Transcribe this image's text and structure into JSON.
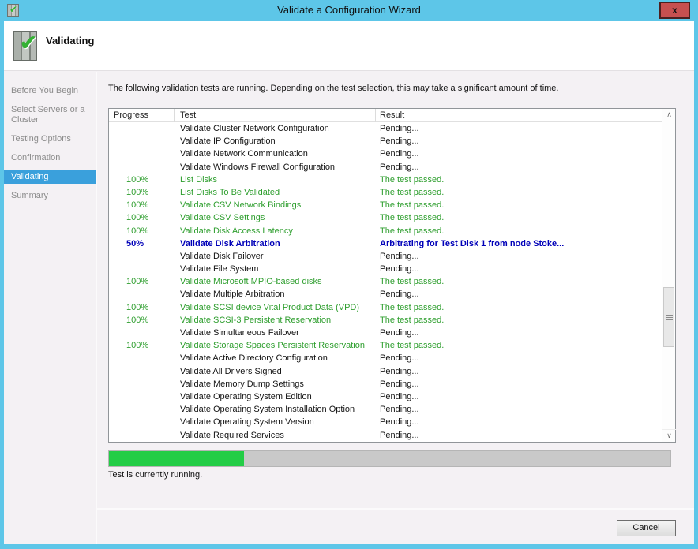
{
  "window": {
    "title": "Validate a Configuration Wizard",
    "close_label": "x"
  },
  "header": {
    "title": "Validating"
  },
  "icons": {
    "check": "✔",
    "scroll_up": "∧",
    "scroll_down": "∨"
  },
  "sidebar": {
    "items": [
      {
        "id": "before-you-begin",
        "label": "Before You Begin",
        "active": false
      },
      {
        "id": "select-servers-or-a-cluster",
        "label": "Select Servers or a Cluster",
        "active": false
      },
      {
        "id": "testing-options",
        "label": "Testing Options",
        "active": false
      },
      {
        "id": "confirmation",
        "label": "Confirmation",
        "active": false
      },
      {
        "id": "validating",
        "label": "Validating",
        "active": true
      },
      {
        "id": "summary",
        "label": "Summary",
        "active": false
      }
    ]
  },
  "main": {
    "instruction": "The following validation tests are running. Depending on the test selection, this may take a significant amount of time.",
    "table": {
      "columns": {
        "progress": "Progress",
        "test": "Test",
        "result": "Result"
      },
      "rows": [
        {
          "progress": "",
          "test": "Validate Cluster Network Configuration",
          "result": "Pending...",
          "status": "pending"
        },
        {
          "progress": "",
          "test": "Validate IP Configuration",
          "result": "Pending...",
          "status": "pending"
        },
        {
          "progress": "",
          "test": "Validate Network Communication",
          "result": "Pending...",
          "status": "pending"
        },
        {
          "progress": "",
          "test": "Validate Windows Firewall Configuration",
          "result": "Pending...",
          "status": "pending"
        },
        {
          "progress": "100%",
          "test": "List Disks",
          "result": "The test passed.",
          "status": "passed"
        },
        {
          "progress": "100%",
          "test": "List Disks To Be Validated",
          "result": "The test passed.",
          "status": "passed"
        },
        {
          "progress": "100%",
          "test": "Validate CSV Network Bindings",
          "result": "The test passed.",
          "status": "passed"
        },
        {
          "progress": "100%",
          "test": "Validate CSV Settings",
          "result": "The test passed.",
          "status": "passed"
        },
        {
          "progress": "100%",
          "test": "Validate Disk Access Latency",
          "result": "The test passed.",
          "status": "passed"
        },
        {
          "progress": "50%",
          "test": "Validate Disk Arbitration",
          "result": "Arbitrating for Test Disk 1 from node Stoke...",
          "status": "running"
        },
        {
          "progress": "",
          "test": "Validate Disk Failover",
          "result": "Pending...",
          "status": "pending"
        },
        {
          "progress": "",
          "test": "Validate File System",
          "result": "Pending...",
          "status": "pending"
        },
        {
          "progress": "100%",
          "test": "Validate Microsoft MPIO-based disks",
          "result": "The test passed.",
          "status": "passed"
        },
        {
          "progress": "",
          "test": "Validate Multiple Arbitration",
          "result": "Pending...",
          "status": "pending"
        },
        {
          "progress": "100%",
          "test": "Validate SCSI device Vital Product Data (VPD)",
          "result": "The test passed.",
          "status": "passed"
        },
        {
          "progress": "100%",
          "test": "Validate SCSI-3 Persistent Reservation",
          "result": "The test passed.",
          "status": "passed"
        },
        {
          "progress": "",
          "test": "Validate Simultaneous Failover",
          "result": "Pending...",
          "status": "pending"
        },
        {
          "progress": "100%",
          "test": "Validate Storage Spaces Persistent Reservation",
          "result": "The test passed.",
          "status": "passed"
        },
        {
          "progress": "",
          "test": "Validate Active Directory Configuration",
          "result": "Pending...",
          "status": "pending"
        },
        {
          "progress": "",
          "test": "Validate All Drivers Signed",
          "result": "Pending...",
          "status": "pending"
        },
        {
          "progress": "",
          "test": "Validate Memory Dump Settings",
          "result": "Pending...",
          "status": "pending"
        },
        {
          "progress": "",
          "test": "Validate Operating System Edition",
          "result": "Pending...",
          "status": "pending"
        },
        {
          "progress": "",
          "test": "Validate Operating System Installation Option",
          "result": "Pending...",
          "status": "pending"
        },
        {
          "progress": "",
          "test": "Validate Operating System Version",
          "result": "Pending...",
          "status": "pending"
        },
        {
          "progress": "",
          "test": "Validate Required Services",
          "result": "Pending...",
          "status": "pending"
        }
      ]
    },
    "progress_bar": {
      "percent": 24
    },
    "status_text": "Test is currently running."
  },
  "footer": {
    "cancel_label": "Cancel"
  },
  "colors": {
    "accent_cyan": "#5dc6e8",
    "close_red": "#c75050",
    "passed_green": "#2e9e2e",
    "running_blue": "#0000b8",
    "progress_green": "#23cd46",
    "sidebar_active_bg": "#3aa0dc"
  }
}
